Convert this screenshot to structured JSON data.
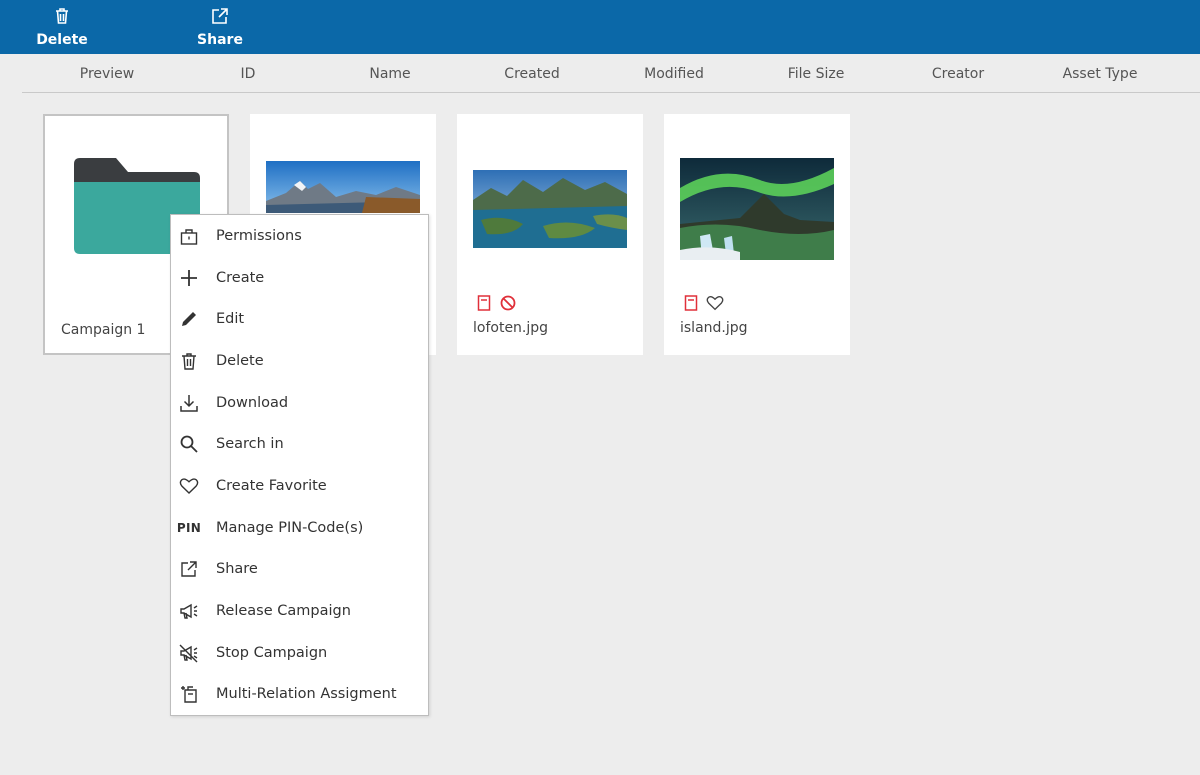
{
  "toolbar": {
    "delete_label": "Delete",
    "share_label": "Share"
  },
  "columns": [
    "Preview",
    "ID",
    "Name",
    "Created",
    "Modified",
    "File Size",
    "Creator",
    "Asset Type"
  ],
  "tiles": [
    {
      "name": "Campaign 1",
      "type": "folder",
      "icon": "folder-icon"
    },
    {
      "name": "",
      "type": "image",
      "image": "matterhorn-mountain-lake"
    },
    {
      "name": "lofoten.jpg",
      "type": "image",
      "image": "lofoten-fjord-islands",
      "icons": [
        "document-icon",
        "block-icon"
      ]
    },
    {
      "name": "island.jpg",
      "type": "image",
      "image": "northern-lights-waterfall",
      "icons": [
        "document-icon",
        "heart-icon"
      ]
    }
  ],
  "context_menu": {
    "items": [
      {
        "label": "Permissions",
        "icon": "lock-icon"
      },
      {
        "label": "Create",
        "icon": "plus-icon"
      },
      {
        "label": "Edit",
        "icon": "pencil-icon"
      },
      {
        "label": "Delete",
        "icon": "trash-icon"
      },
      {
        "label": "Download",
        "icon": "download-icon"
      },
      {
        "label": "Search in",
        "icon": "search-icon"
      },
      {
        "label": "Create Favorite",
        "icon": "heart-icon"
      },
      {
        "label": "Manage PIN-Code(s)",
        "icon": "pin-icon",
        "icon_text": "PIN"
      },
      {
        "label": "Share",
        "icon": "share-icon"
      },
      {
        "label": "Release Campaign",
        "icon": "megaphone-icon"
      },
      {
        "label": "Stop Campaign",
        "icon": "megaphone-off-icon"
      },
      {
        "label": "Multi-Relation Assigment",
        "icon": "multi-relation-icon"
      }
    ]
  },
  "colors": {
    "toolbar": "#0b68a8",
    "folder_body": "#3ba89d",
    "folder_tab": "#3a3d40",
    "status_red": "#e0303a"
  }
}
